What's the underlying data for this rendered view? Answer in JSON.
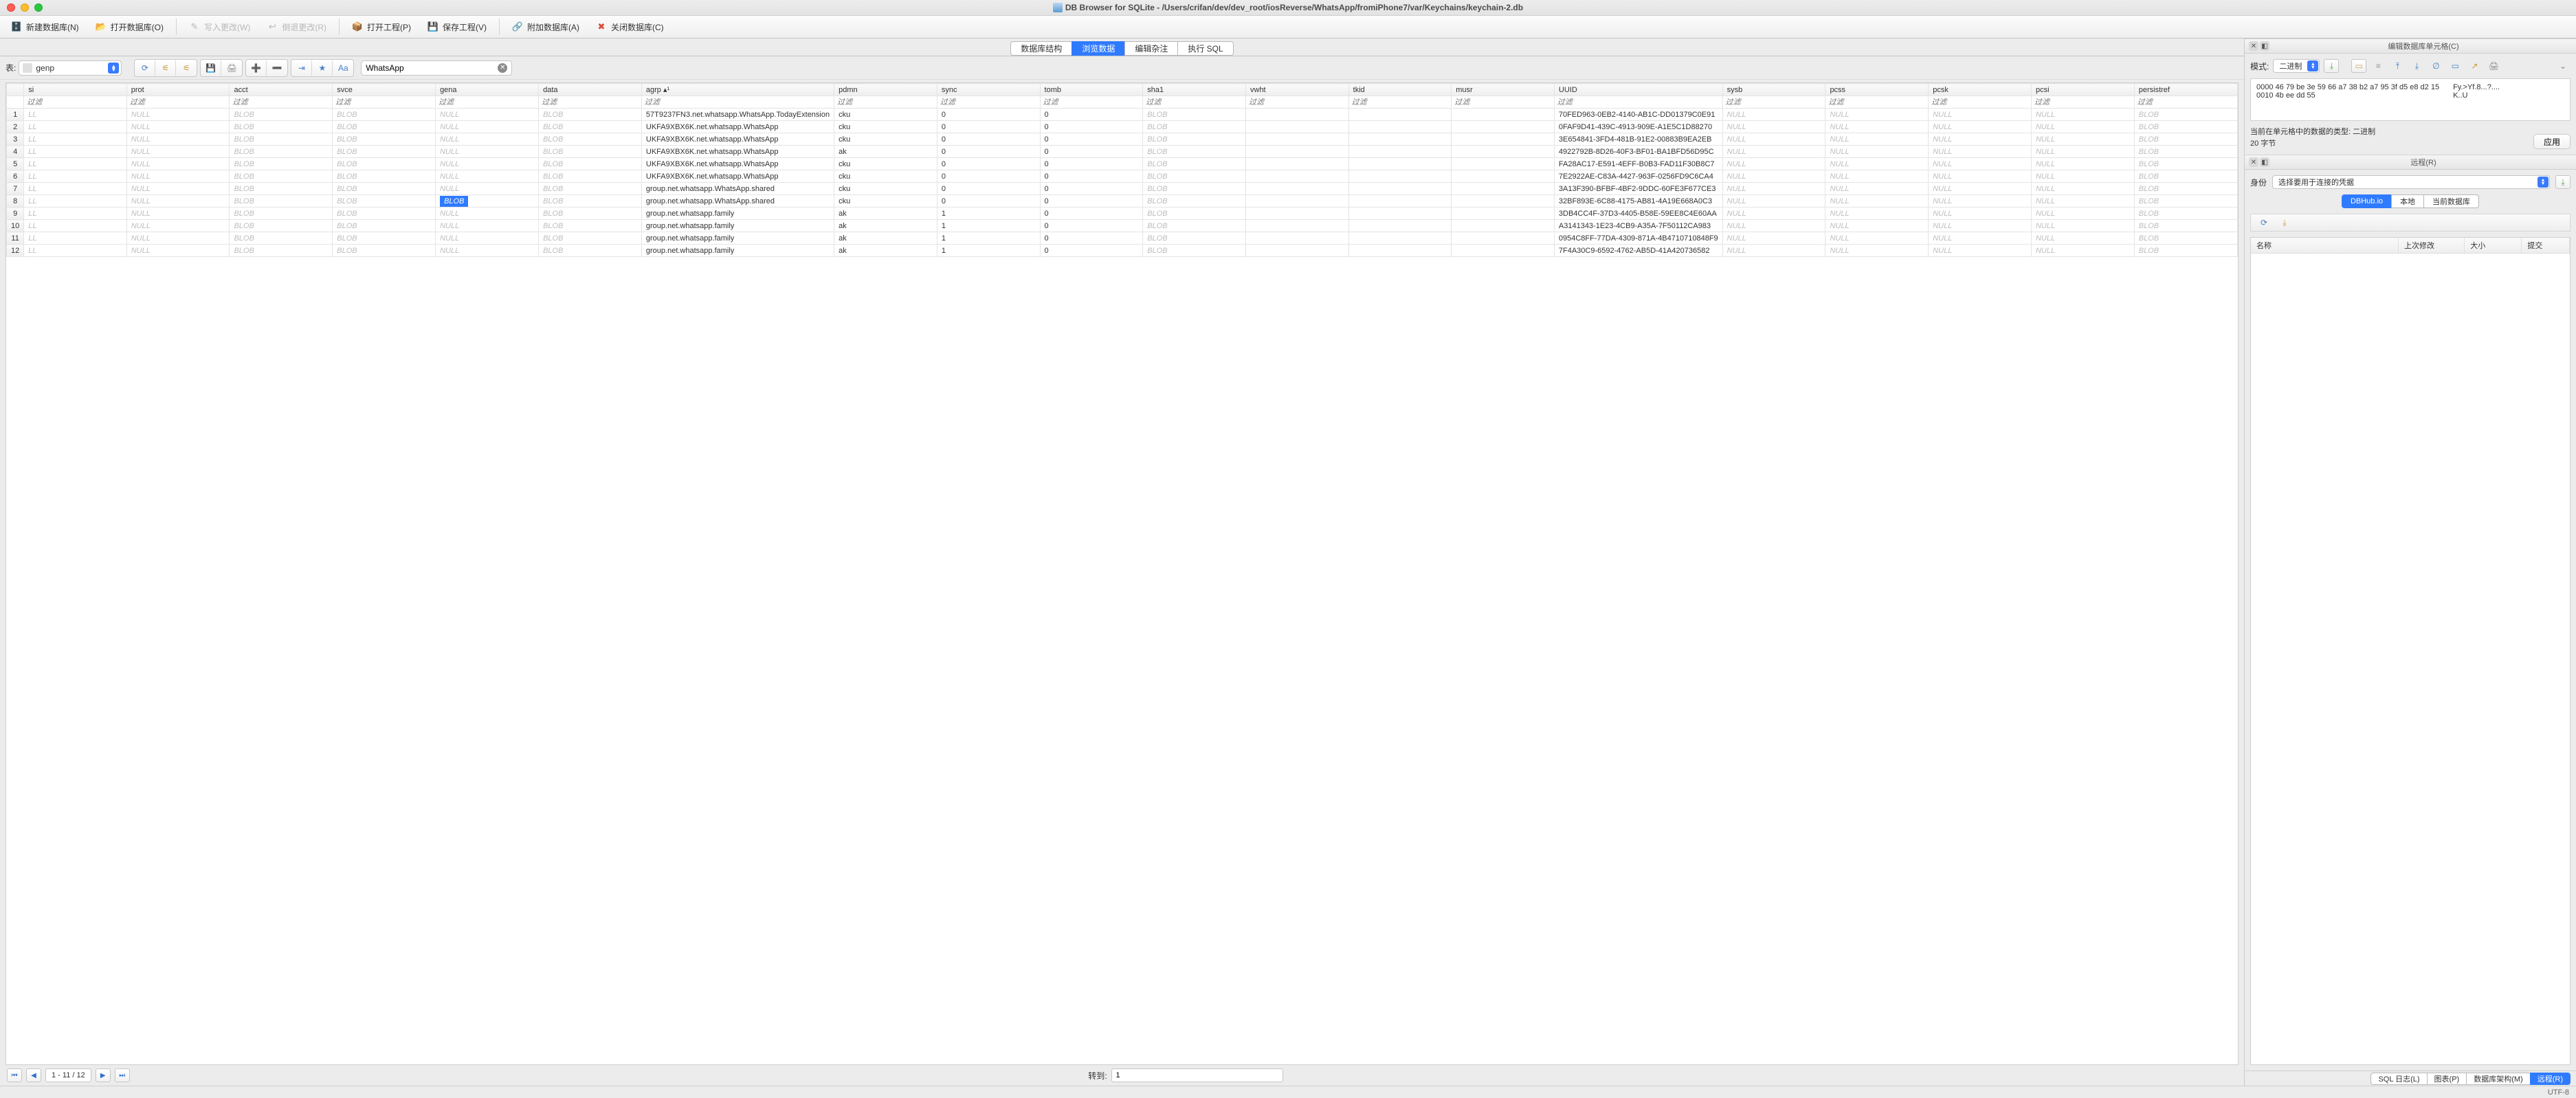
{
  "window": {
    "title": "DB Browser for SQLite - /Users/crifan/dev/dev_root/iosReverse/WhatsApp/fromiPhone7/var/Keychains/keychain-2.db"
  },
  "toolbar": {
    "new_db": "新建数据库(N)",
    "open_db": "打开数据库(O)",
    "write_changes": "写入更改(W)",
    "revert_changes": "倒退更改(R)",
    "open_project": "打开工程(P)",
    "save_project": "保存工程(V)",
    "attach_db": "附加数据库(A)",
    "close_db": "关闭数据库(C)"
  },
  "tabs": {
    "structure": "数据库结构",
    "browse": "浏览数据",
    "pragma": "编辑杂注",
    "exec_sql": "执行 SQL"
  },
  "subbar": {
    "table_label": "表:",
    "table_selected": "genp",
    "search_value": "WhatsApp"
  },
  "columns": [
    "",
    "si",
    "prot",
    "acct",
    "svce",
    "gena",
    "data",
    "agrp ▴¹",
    "pdmn",
    "sync",
    "tomb",
    "sha1",
    "vwht",
    "tkid",
    "musr",
    "UUID",
    "sysb",
    "pcss",
    "pcsk",
    "pcsi",
    "persistref"
  ],
  "filter_placeholder": "过滤",
  "null_text": "NULL",
  "blob_text": "BLOB",
  "rows": [
    {
      "n": "1",
      "si": "LL",
      "prot": "NULL",
      "acct": "BLOB",
      "svce": "BLOB",
      "gena": "NULL",
      "data": "BLOB",
      "agrp": "57T9237FN3.net.whatsapp.WhatsApp.TodayExtension",
      "pdmn": "cku",
      "sync": "0",
      "tomb": "0",
      "sha1": "BLOB",
      "vwht": "",
      "tkid": "",
      "musr": "",
      "uuid": "70FED963-0EB2-4140-AB1C-DD01379C0E91",
      "sysb": "NULL",
      "pcss": "NULL",
      "pcsk": "NULL",
      "pcsi": "NULL",
      "persist": "BLOB"
    },
    {
      "n": "2",
      "si": "LL",
      "prot": "NULL",
      "acct": "BLOB",
      "svce": "BLOB",
      "gena": "NULL",
      "data": "BLOB",
      "agrp": "UKFA9XBX6K.net.whatsapp.WhatsApp",
      "pdmn": "cku",
      "sync": "0",
      "tomb": "0",
      "sha1": "BLOB",
      "vwht": "",
      "tkid": "",
      "musr": "",
      "uuid": "0FAF9D41-439C-4913-909E-A1E5C1D88270",
      "sysb": "NULL",
      "pcss": "NULL",
      "pcsk": "NULL",
      "pcsi": "NULL",
      "persist": "BLOB"
    },
    {
      "n": "3",
      "si": "LL",
      "prot": "NULL",
      "acct": "BLOB",
      "svce": "BLOB",
      "gena": "NULL",
      "data": "BLOB",
      "agrp": "UKFA9XBX6K.net.whatsapp.WhatsApp",
      "pdmn": "cku",
      "sync": "0",
      "tomb": "0",
      "sha1": "BLOB",
      "vwht": "",
      "tkid": "",
      "musr": "",
      "uuid": "3E654841-3FD4-481B-91E2-00883B9EA2EB",
      "sysb": "NULL",
      "pcss": "NULL",
      "pcsk": "NULL",
      "pcsi": "NULL",
      "persist": "BLOB"
    },
    {
      "n": "4",
      "si": "LL",
      "prot": "NULL",
      "acct": "BLOB",
      "svce": "BLOB",
      "gena": "NULL",
      "data": "BLOB",
      "agrp": "UKFA9XBX6K.net.whatsapp.WhatsApp",
      "pdmn": "ak",
      "sync": "0",
      "tomb": "0",
      "sha1": "BLOB",
      "vwht": "",
      "tkid": "",
      "musr": "",
      "uuid": "4922792B-8D26-40F3-BF01-BA1BFD56D95C",
      "sysb": "NULL",
      "pcss": "NULL",
      "pcsk": "NULL",
      "pcsi": "NULL",
      "persist": "BLOB"
    },
    {
      "n": "5",
      "si": "LL",
      "prot": "NULL",
      "acct": "BLOB",
      "svce": "BLOB",
      "gena": "NULL",
      "data": "BLOB",
      "agrp": "UKFA9XBX6K.net.whatsapp.WhatsApp",
      "pdmn": "cku",
      "sync": "0",
      "tomb": "0",
      "sha1": "BLOB",
      "vwht": "",
      "tkid": "",
      "musr": "",
      "uuid": "FA28AC17-E591-4EFF-B0B3-FAD11F30B8C7",
      "sysb": "NULL",
      "pcss": "NULL",
      "pcsk": "NULL",
      "pcsi": "NULL",
      "persist": "BLOB"
    },
    {
      "n": "6",
      "si": "LL",
      "prot": "NULL",
      "acct": "BLOB",
      "svce": "BLOB",
      "gena": "NULL",
      "data": "BLOB",
      "agrp": "UKFA9XBX6K.net.whatsapp.WhatsApp",
      "pdmn": "cku",
      "sync": "0",
      "tomb": "0",
      "sha1": "BLOB",
      "vwht": "",
      "tkid": "",
      "musr": "",
      "uuid": "7E2922AE-C83A-4427-963F-0256FD9C6CA4",
      "sysb": "NULL",
      "pcss": "NULL",
      "pcsk": "NULL",
      "pcsi": "NULL",
      "persist": "BLOB"
    },
    {
      "n": "7",
      "si": "LL",
      "prot": "NULL",
      "acct": "BLOB",
      "svce": "BLOB",
      "gena": "NULL",
      "data": "BLOB",
      "agrp": "group.net.whatsapp.WhatsApp.shared",
      "pdmn": "cku",
      "sync": "0",
      "tomb": "0",
      "sha1": "BLOB",
      "vwht": "",
      "tkid": "",
      "musr": "",
      "uuid": "3A13F390-BFBF-4BF2-9DDC-60FE3F677CE3",
      "sysb": "NULL",
      "pcss": "NULL",
      "pcsk": "NULL",
      "pcsi": "NULL",
      "persist": "BLOB"
    },
    {
      "n": "8",
      "si": "LL",
      "prot": "NULL",
      "acct": "BLOB",
      "svce": "BLOB",
      "gena": "BLOB",
      "data": "BLOB",
      "agrp": "group.net.whatsapp.WhatsApp.shared",
      "pdmn": "cku",
      "sync": "0",
      "tomb": "0",
      "sha1": "BLOB",
      "vwht": "",
      "tkid": "",
      "musr": "",
      "uuid": "32BF893E-6C88-4175-AB81-4A19E668A0C3",
      "sysb": "NULL",
      "pcss": "NULL",
      "pcsk": "NULL",
      "pcsi": "NULL",
      "persist": "BLOB",
      "sel_gena": true
    },
    {
      "n": "9",
      "si": "LL",
      "prot": "NULL",
      "acct": "BLOB",
      "svce": "BLOB",
      "gena": "NULL",
      "data": "BLOB",
      "agrp": "group.net.whatsapp.family",
      "pdmn": "ak",
      "sync": "1",
      "tomb": "0",
      "sha1": "BLOB",
      "vwht": "",
      "tkid": "",
      "musr": "",
      "uuid": "3DB4CC4F-37D3-4405-B58E-59EE8C4E60AA",
      "sysb": "NULL",
      "pcss": "NULL",
      "pcsk": "NULL",
      "pcsi": "NULL",
      "persist": "BLOB"
    },
    {
      "n": "10",
      "si": "LL",
      "prot": "NULL",
      "acct": "BLOB",
      "svce": "BLOB",
      "gena": "NULL",
      "data": "BLOB",
      "agrp": "group.net.whatsapp.family",
      "pdmn": "ak",
      "sync": "1",
      "tomb": "0",
      "sha1": "BLOB",
      "vwht": "",
      "tkid": "",
      "musr": "",
      "uuid": "A3141343-1E23-4CB9-A35A-7F50112CA983",
      "sysb": "NULL",
      "pcss": "NULL",
      "pcsk": "NULL",
      "pcsi": "NULL",
      "persist": "BLOB"
    },
    {
      "n": "11",
      "si": "LL",
      "prot": "NULL",
      "acct": "BLOB",
      "svce": "BLOB",
      "gena": "NULL",
      "data": "BLOB",
      "agrp": "group.net.whatsapp.family",
      "pdmn": "ak",
      "sync": "1",
      "tomb": "0",
      "sha1": "BLOB",
      "vwht": "",
      "tkid": "",
      "musr": "",
      "uuid": "0954C8FF-77DA-4309-871A-4B4710710848F9",
      "sysb": "NULL",
      "pcss": "NULL",
      "pcsk": "NULL",
      "pcsi": "NULL",
      "persist": "BLOB"
    },
    {
      "n": "12",
      "si": "LL",
      "prot": "NULL",
      "acct": "BLOB",
      "svce": "BLOB",
      "gena": "NULL",
      "data": "BLOB",
      "agrp": "group.net.whatsapp.family",
      "pdmn": "ak",
      "sync": "1",
      "tomb": "0",
      "sha1": "BLOB",
      "vwht": "",
      "tkid": "",
      "musr": "",
      "uuid": "7F4A30C9-6592-4762-AB5D-41A420736582",
      "sysb": "NULL",
      "pcss": "NULL",
      "pcsk": "NULL",
      "pcsi": "NULL",
      "persist": "BLOB"
    }
  ],
  "pager": {
    "info": "1 - 11 / 12",
    "goto_label": "转到:",
    "goto_value": "1"
  },
  "editcell": {
    "panel_title": "编辑数据库单元格(C)",
    "mode_label": "模式:",
    "mode_value": "二进制",
    "hex_left": "0000 46 79 be 3e 59 66 a7 38 b2 a7 95 3f d5 e8 d2 15\n0010 4b ee dd 55",
    "hex_right": "Fy.>Yf.8...?....\nK..U",
    "meta_line1": "当前在单元格中的数据的类型: 二进制",
    "meta_line2": "20 字节",
    "apply": "应用"
  },
  "remote": {
    "panel_title": "远程(R)",
    "identity_label": "身份",
    "identity_value": "选择要用于连接的凭据",
    "tabs": {
      "dbhub": "DBHub.io",
      "local": "本地",
      "current": "当前数据库"
    },
    "cols": {
      "name": "名称",
      "modified": "上次修改",
      "size": "大小",
      "commit": "提交"
    }
  },
  "bottom_tabs": {
    "sql_log": "SQL 日志(L)",
    "chart": "图表(P)",
    "schema": "数据库架构(M)",
    "remote": "远程(R)"
  },
  "status": {
    "encoding": "UTF-8"
  }
}
